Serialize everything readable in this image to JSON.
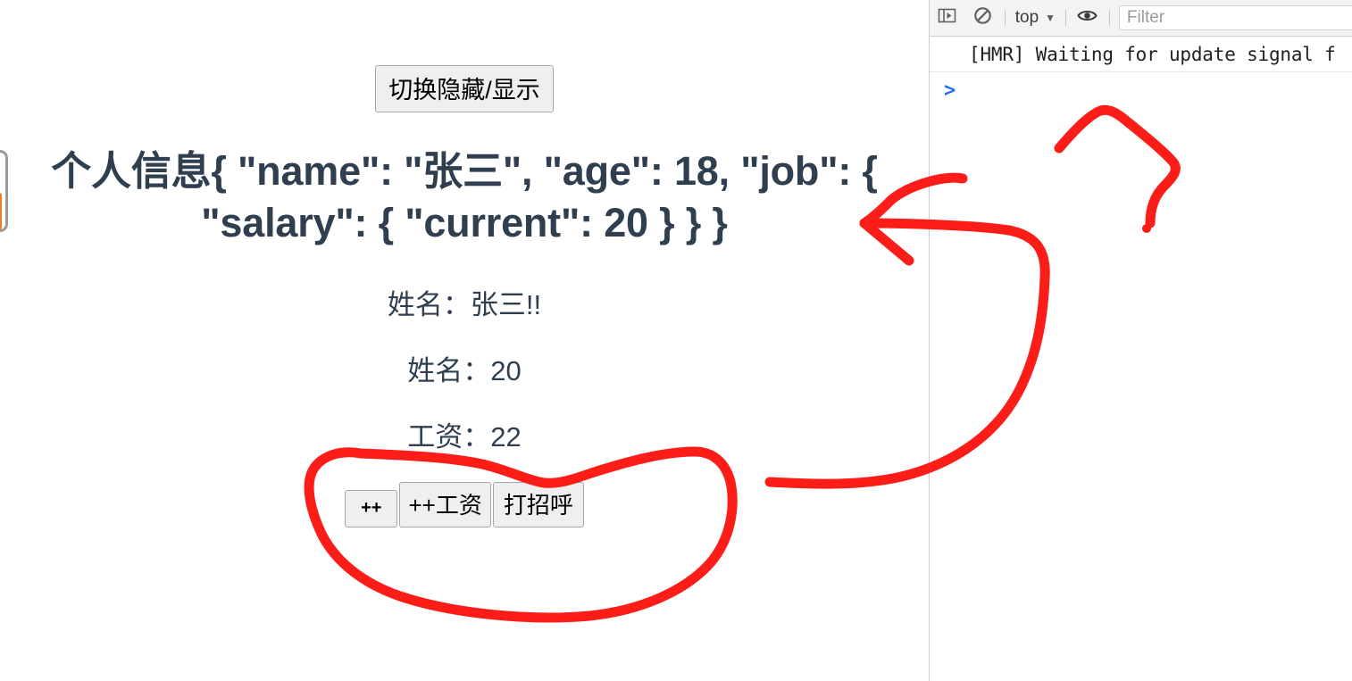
{
  "page": {
    "toggle_button_label": "切换隐藏/显示",
    "heading_text": "个人信息{ \"name\": \"张三\", \"age\": 18, \"job\": { \"salary\": { \"current\": 20 } } }",
    "heading_color": "#2f3f50",
    "lines": [
      {
        "name": "name-line",
        "text": "姓名：张三!!"
      },
      {
        "name": "age-line",
        "text": "姓名：20"
      },
      {
        "name": "salary-line",
        "text": "工资：22"
      }
    ],
    "buttons": [
      {
        "name": "increment-button",
        "label": "++"
      },
      {
        "name": "increment-salary-button",
        "label": "++工资"
      },
      {
        "name": "greet-button",
        "label": "打招呼"
      }
    ],
    "edge_widget": {
      "fill_color": "#f47b20",
      "border_color": "#9a9a9a"
    }
  },
  "devtools": {
    "toolbar": {
      "sidebar_toggle_icon": "console-sidebar-icon",
      "clear_console_icon": "clear-console-icon",
      "context_label": "top",
      "context_caret": "▼",
      "eye_icon": "eye-icon",
      "filter_placeholder": "Filter",
      "filter_value": ""
    },
    "console": {
      "messages": [
        {
          "name": "hmr-message",
          "text": "[HMR] Waiting for update signal f"
        }
      ],
      "prompt_caret": ">"
    }
  },
  "annotations": {
    "stroke_color": "#fc1d18",
    "items": [
      {
        "name": "arrow-to-heading",
        "type": "arrow"
      },
      {
        "name": "circle-around-buttons",
        "type": "circle"
      },
      {
        "name": "scribble-top-right",
        "type": "scribble"
      },
      {
        "name": "dot-mark",
        "type": "dot"
      }
    ]
  }
}
